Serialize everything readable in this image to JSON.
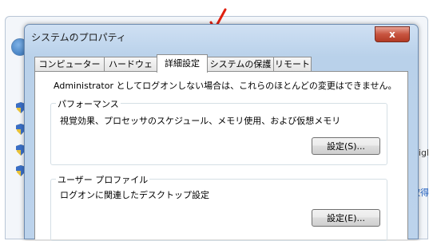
{
  "background": {
    "fragment_text_1": "rigl",
    "fragment_text_2": "取得"
  },
  "dialog": {
    "title": "システムのプロパティ",
    "close_label": "x",
    "tabs": [
      {
        "label": "コンピューター名"
      },
      {
        "label": "ハードウェア"
      },
      {
        "label": "詳細設定"
      },
      {
        "label": "システムの保護"
      },
      {
        "label": "リモート"
      }
    ],
    "active_tab": "詳細設定",
    "admin_note": "Administrator としてログオンしない場合は、これらのほとんどの変更はできません。",
    "performance": {
      "label": "パフォーマンス",
      "description": "視覚効果、プロセッサのスケジュール、メモリ使用、および仮想メモリ",
      "button": "設定(S)..."
    },
    "user_profile": {
      "label": "ユーザー プロファイル",
      "description": "ログオンに関連したデスクトップ設定",
      "button": "設定(E)..."
    }
  },
  "colors": {
    "arrow": "#e02010",
    "close_button": "#c7543f",
    "dialog_frame": "#bcd3ec"
  }
}
